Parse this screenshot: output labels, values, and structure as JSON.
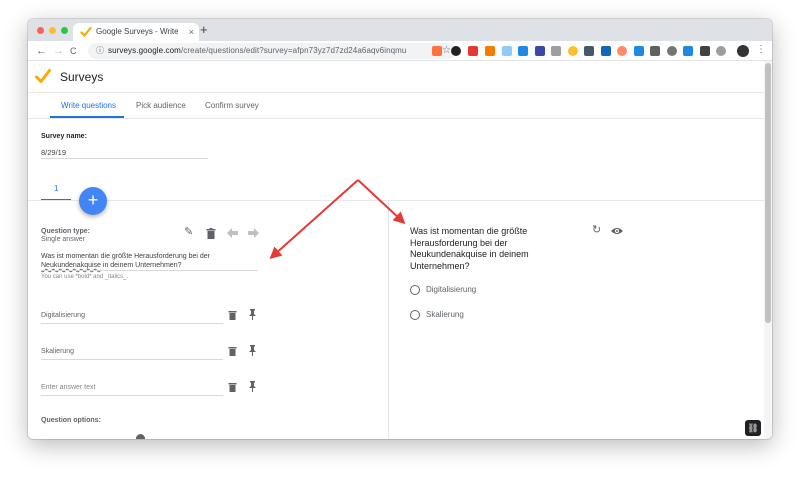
{
  "browser": {
    "tab_title": "Google Surveys - Write questio",
    "tab_close": "×",
    "new_tab": "+",
    "nav_back": "←",
    "nav_forward": "→",
    "nav_reload": "C",
    "url_host": "surveys.google.com",
    "url_path": "/create/questions/edit?survey=afpn73yz7d7zd24a6aqv6inqmu",
    "lock": "ⓘ",
    "star": "☆",
    "menu": "⋮"
  },
  "app": {
    "title": "Surveys",
    "tabs": [
      "Write questions",
      "Pick audience",
      "Confirm survey"
    ],
    "active_tab": 0,
    "accent": "#1a73e8",
    "logo_color": "#f9ab00"
  },
  "survey": {
    "name_label": "Survey name:",
    "name_value": "8/29/19",
    "question_tab": "1",
    "add_button": "+"
  },
  "editor": {
    "type_label": "Question type:",
    "type_value": "Single answer",
    "question_part1": "Was ist momentan die größte Herausforderung bei der",
    "question_underlined": "Neukundenakquise",
    "question_part2": " in deinem Unternehmen?",
    "hint": "You can use *bold* and _italics_.",
    "answers": [
      "Digitalisierung",
      "Skalierung"
    ],
    "answer_placeholder": "Enter answer text",
    "options_label": "Question options:",
    "icons": {
      "edit": "✎",
      "delete": "🗑",
      "up": "⬆",
      "down": "➡",
      "pin": "📌"
    }
  },
  "preview": {
    "question": "Was ist momentan die größte Herausforderung bei der Neukundenakquise in deinem Unternehmen?",
    "options": [
      "Digitalisierung",
      "Skalierung"
    ],
    "reload_icon": "↻",
    "eye_icon": "👁"
  },
  "overlay": {
    "arrow_color": "#e53935"
  }
}
